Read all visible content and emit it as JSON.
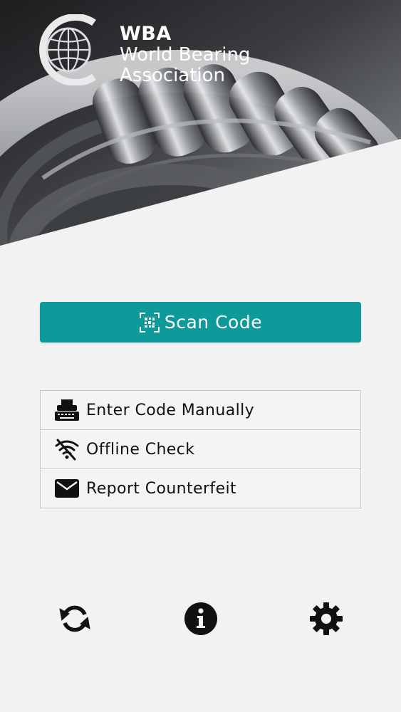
{
  "brand": {
    "abbr": "WBA",
    "line1": "World Bearing",
    "line2": "Association"
  },
  "primary_action": {
    "label": "Scan Code",
    "icon": "qr-scan-icon",
    "color": "#0e9a9a"
  },
  "menu": [
    {
      "label": "Enter Code Manually",
      "icon": "keyboard-printer-icon"
    },
    {
      "label": "Offline Check",
      "icon": "wifi-off-icon"
    },
    {
      "label": "Report Counterfeit",
      "icon": "mail-icon"
    }
  ],
  "footer": [
    {
      "icon": "sync-icon"
    },
    {
      "icon": "info-icon"
    },
    {
      "icon": "gear-icon"
    }
  ]
}
